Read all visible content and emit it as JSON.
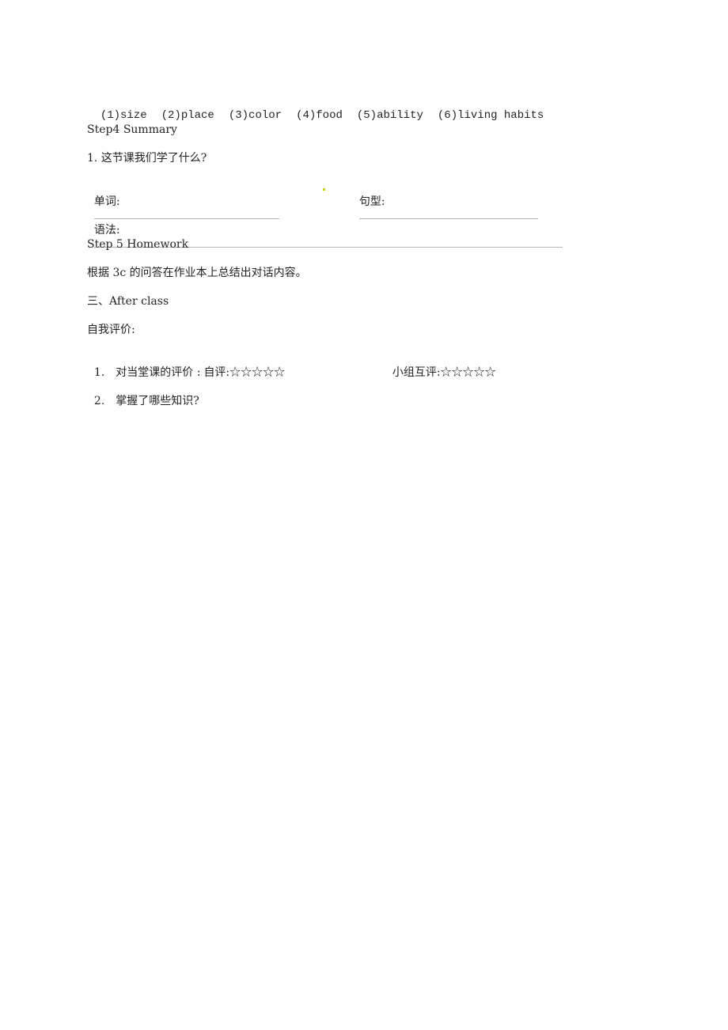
{
  "categories_line": [
    "(1)size",
    "(2)place",
    "(3)color",
    "(4)food",
    "(5)ability",
    "(6)living habits"
  ],
  "step4": {
    "heading": "Step4 Summary",
    "question1": "1. 这节课我们学了什么?",
    "words_label": "单词:",
    "sentence_label": "句型:",
    "grammar_label": "语法:"
  },
  "step5": {
    "heading": "Step 5 Homework",
    "task": "根据 3c 的问答在作业本上总结出对话内容。"
  },
  "after_class": {
    "heading": "三、After class",
    "self_eval_label": "自我评价:",
    "item1_number": "1.",
    "item1_text": "对当堂课的评价 :",
    "self_rating_label": "自评:",
    "self_rating_stars": "☆☆☆☆☆",
    "group_rating_label": "小组互评:",
    "group_rating_stars": "☆☆☆☆☆",
    "item2_number": "2.",
    "item2_text": "掌握了哪些知识?"
  }
}
